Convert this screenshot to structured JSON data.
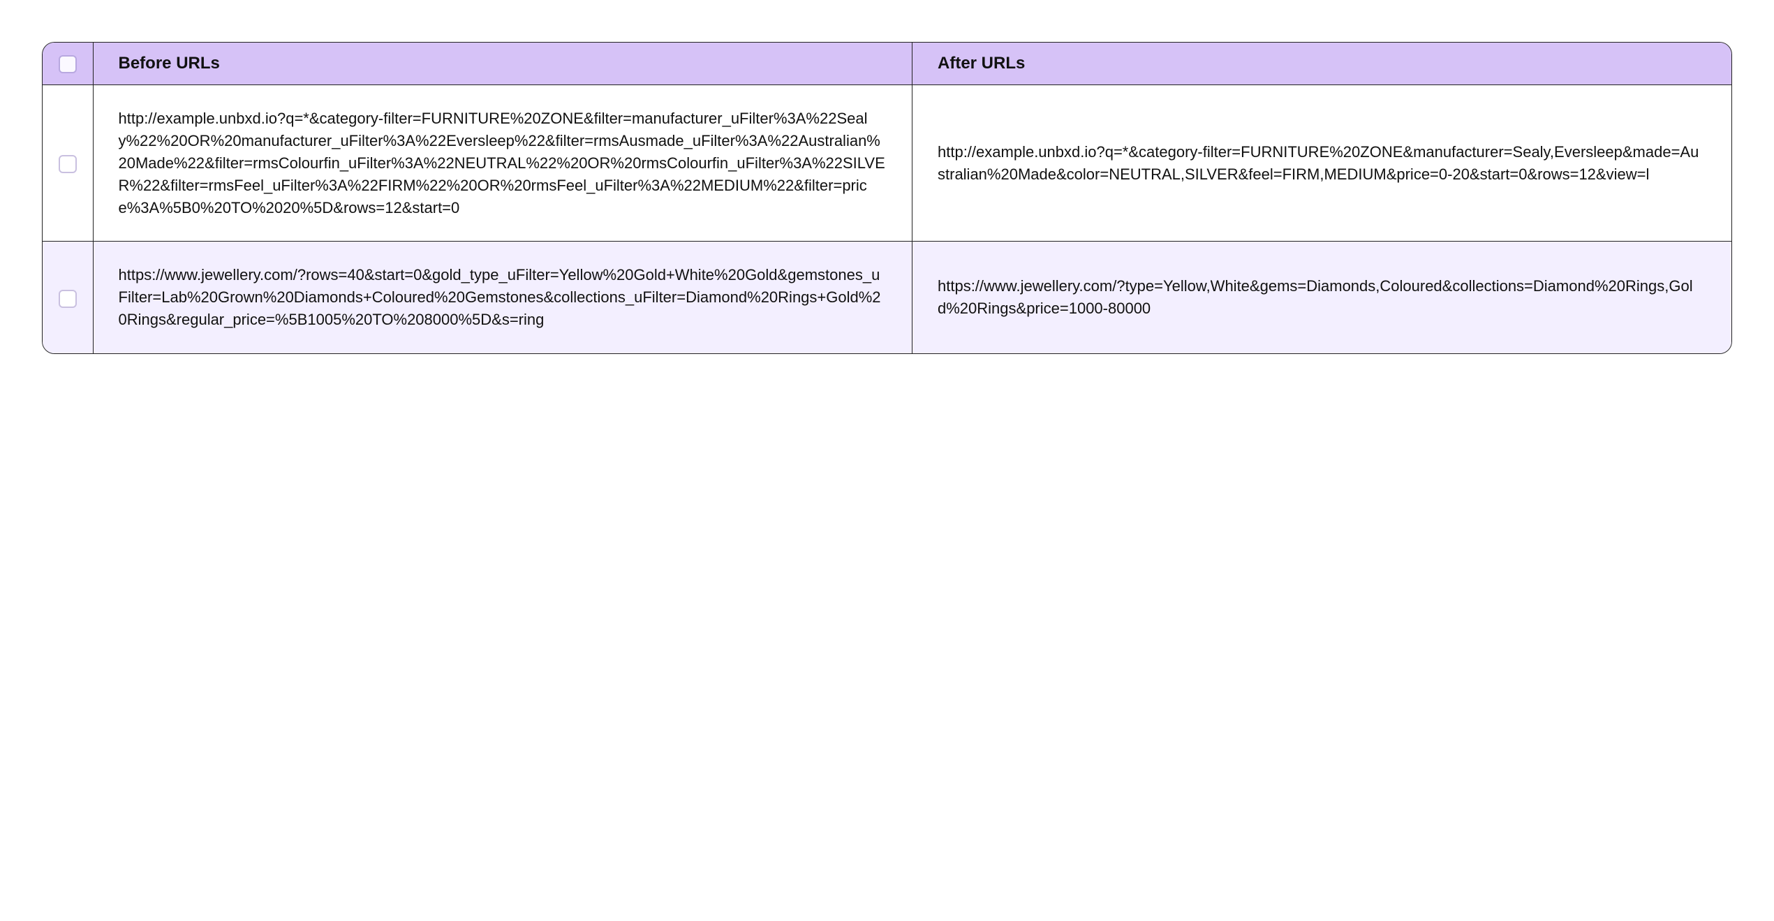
{
  "table": {
    "headers": {
      "before": "Before URLs",
      "after": "After URLs"
    },
    "rows": [
      {
        "before": "http://example.unbxd.io?q=*&category-filter=FURNITURE%20ZONE&filter=manufacturer_uFilter%3A%22Sealy%22%20OR%20manufacturer_uFilter%3A%22Eversleep%22&filter=rmsAusmade_uFilter%3A%22Australian%20Made%22&filter=rmsColourfin_uFilter%3A%22NEUTRAL%22%20OR%20rmsColourfin_uFilter%3A%22SILVER%22&filter=rmsFeel_uFilter%3A%22FIRM%22%20OR%20rmsFeel_uFilter%3A%22MEDIUM%22&filter=price%3A%5B0%20TO%2020%5D&rows=12&start=0",
        "after": "http://example.unbxd.io?q=*&category-filter=FURNITURE%20ZONE&manufacturer=Sealy,Eversleep&made=Australian%20Made&color=NEUTRAL,SILVER&feel=FIRM,MEDIUM&price=0-20&start=0&rows=12&view=l"
      },
      {
        "before": "https://www.jewellery.com/?rows=40&start=0&gold_type_uFilter=Yellow%20Gold+White%20Gold&gemstones_uFilter=Lab%20Grown%20Diamonds+Coloured%20Gemstones&collections_uFilter=Diamond%20Rings+Gold%20Rings&regular_price=%5B1005%20TO%208000%5D&s=ring",
        "after": "https://www.jewellery.com/?type=Yellow,White&gems=Diamonds,Coloured&collections=Diamond%20Rings,Gold%20Rings&price=1000-80000"
      }
    ]
  }
}
